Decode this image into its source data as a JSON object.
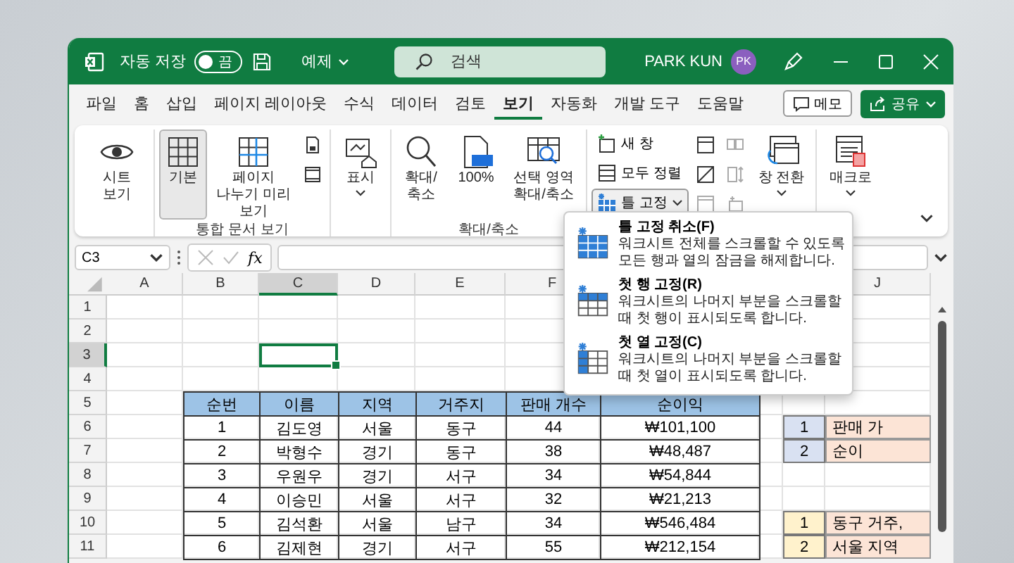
{
  "title_bar": {
    "autosave_label": "자동 저장",
    "autosave": {
      "on": false,
      "text": "끔"
    },
    "file_name": "예제",
    "search": {
      "placeholder": "검색"
    },
    "user_name": "PARK KUN",
    "user_initials": "PK"
  },
  "tabs": [
    {
      "label": "파일",
      "selected": false
    },
    {
      "label": "홈",
      "selected": false
    },
    {
      "label": "삽입",
      "selected": false
    },
    {
      "label": "페이지 레이아웃",
      "selected": false
    },
    {
      "label": "수식",
      "selected": false
    },
    {
      "label": "데이터",
      "selected": false
    },
    {
      "label": "검토",
      "selected": false
    },
    {
      "label": "보기",
      "selected": true
    },
    {
      "label": "자동화",
      "selected": false
    },
    {
      "label": "개발 도구",
      "selected": false
    },
    {
      "label": "도움말",
      "selected": false
    }
  ],
  "comments_button": "메모",
  "share_button": "공유",
  "ribbon": {
    "sheet_view": "시트 보기",
    "workbook_views": {
      "label": "통합 문서 보기",
      "buttons": [
        {
          "label": "기본",
          "selected": true
        },
        {
          "label": "페이지 나누기 미리 보기",
          "selected": false
        }
      ]
    },
    "show": "표시",
    "zoom": {
      "label": "확대/축소",
      "buttons": [
        "확대/축소",
        "100%",
        "선택 영역 확대/축소"
      ]
    },
    "window": {
      "new_window": "새 창",
      "arrange_all": "모두 정렬",
      "freeze_panes": {
        "label": "틀 고정",
        "expanded": true
      },
      "switch_windows": "창 전환"
    },
    "macros": "매크로"
  },
  "freeze_menu": [
    {
      "title": "틀 고정 취소(F)",
      "description": "워크시트 전체를 스크롤할 수 있도록 모든 행과 열의 잠금을 해제합니다."
    },
    {
      "title": "첫 행 고정(R)",
      "description": "워크시트의 나머지 부분을 스크롤할 때 첫 행이 표시되도록 합니다."
    },
    {
      "title": "첫 열 고정(C)",
      "description": "워크시트의 나머지 부분을 스크롤할 때 첫 열이 표시되도록 합니다."
    }
  ],
  "formula_bar": {
    "name_box": "C3",
    "function_label": "fx"
  },
  "sheet": {
    "column_headers": [
      {
        "label": "A",
        "selected": false
      },
      {
        "label": "B",
        "selected": false
      },
      {
        "label": "C",
        "selected": true
      },
      {
        "label": "D",
        "selected": false
      },
      {
        "label": "E",
        "selected": false
      },
      {
        "label": "F",
        "selected": false
      },
      {
        "label": "J",
        "selected": false
      }
    ],
    "rows": [
      {
        "label": "1",
        "selected": false
      },
      {
        "label": "2",
        "selected": false
      },
      {
        "label": "3",
        "selected": true
      },
      {
        "label": "4",
        "selected": false
      },
      {
        "label": "5",
        "selected": false,
        "table_header": [
          "순번",
          "이름",
          "지역",
          "거주지",
          "판매 개수",
          "순이익"
        ]
      },
      {
        "label": "6",
        "selected": false,
        "cells": [
          "1",
          "김도영",
          "서울",
          "동구",
          "44",
          "₩101,100"
        ],
        "side": {
          "number": "1",
          "text": "판매 가",
          "color": "#d9e1f2"
        }
      },
      {
        "label": "7",
        "selected": false,
        "cells": [
          "2",
          "박형수",
          "경기",
          "동구",
          "38",
          "₩48,487"
        ],
        "side": {
          "number": "2",
          "text": "순이",
          "color": "#d9e1f2"
        }
      },
      {
        "label": "8",
        "selected": false,
        "cells": [
          "3",
          "우원우",
          "경기",
          "서구",
          "34",
          "₩54,844"
        ]
      },
      {
        "label": "9",
        "selected": false,
        "cells": [
          "4",
          "이승민",
          "서울",
          "서구",
          "32",
          "₩21,213"
        ]
      },
      {
        "label": "10",
        "selected": false,
        "cells": [
          "5",
          "김석환",
          "서울",
          "남구",
          "34",
          "₩546,484"
        ],
        "side": {
          "number": "1",
          "text": "동구 거주,",
          "color": "#fff2cc"
        }
      },
      {
        "label": "11",
        "selected": false,
        "cells": [
          "6",
          "김제현",
          "경기",
          "서구",
          "55",
          "₩212,154"
        ],
        "side": {
          "number": "2",
          "text": "서울 지역",
          "color": "#fff2cc"
        }
      }
    ]
  }
}
